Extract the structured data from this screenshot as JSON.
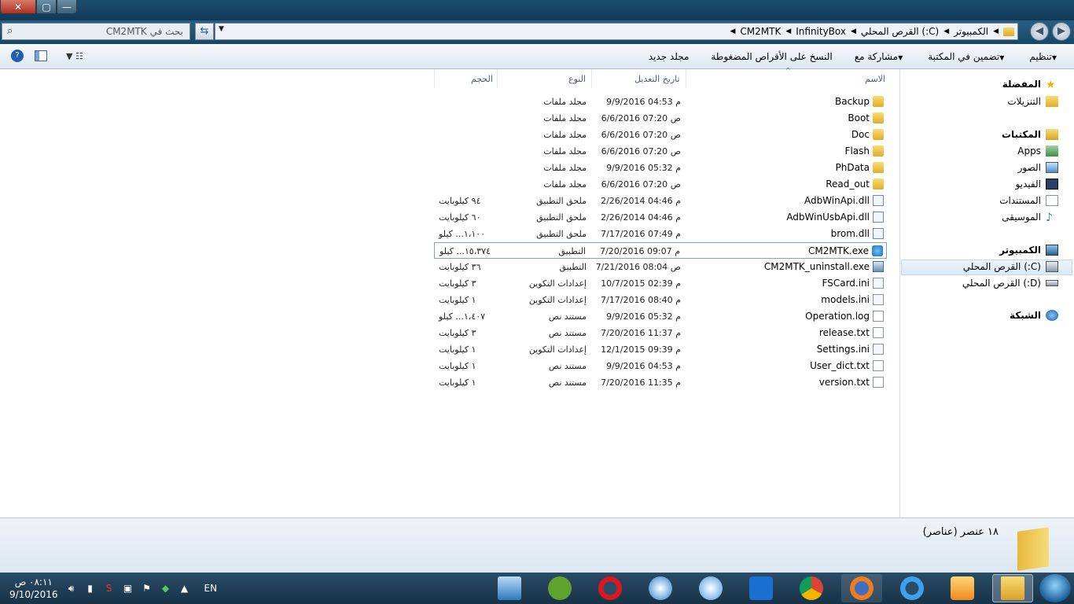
{
  "window": {
    "close_label": "✕",
    "max_label": "▢",
    "min_label": "—"
  },
  "address": {
    "search_placeholder": "بحث في CM2MTK",
    "crumbs": [
      "الكمبيوتر",
      "القرص المحلي (:C)",
      "InfinityBox",
      "CM2MTK"
    ]
  },
  "toolbar": {
    "organize": "تنظيم",
    "include_library": "تضمين في المكتبة",
    "share_with": "مشاركة مع",
    "burn": "النسخ على الأقراص المضغوطة",
    "new_folder": "مجلد جديد"
  },
  "columns": {
    "name": "الاسم",
    "date": "تاريخ التعديل",
    "type": "النوع",
    "size": "الحجم"
  },
  "files": [
    {
      "name": "Backup",
      "date": "9/9/2016 04:53 م",
      "type": "مجلد ملفات",
      "size": "",
      "icon": "folder-icon"
    },
    {
      "name": "Boot",
      "date": "6/6/2016 07:20 ص",
      "type": "مجلد ملفات",
      "size": "",
      "icon": "folder-icon"
    },
    {
      "name": "Doc",
      "date": "6/6/2016 07:20 ص",
      "type": "مجلد ملفات",
      "size": "",
      "icon": "folder-icon"
    },
    {
      "name": "Flash",
      "date": "6/6/2016 07:20 ص",
      "type": "مجلد ملفات",
      "size": "",
      "icon": "folder-icon"
    },
    {
      "name": "PhData",
      "date": "9/9/2016 05:32 م",
      "type": "مجلد ملفات",
      "size": "",
      "icon": "folder-icon"
    },
    {
      "name": "Read_out",
      "date": "6/6/2016 07:20 ص",
      "type": "مجلد ملفات",
      "size": "",
      "icon": "folder-icon"
    },
    {
      "name": "AdbWinApi.dll",
      "date": "2/26/2014 04:46 م",
      "type": "ملحق التطبيق",
      "size": "٩٤ كيلوبايت",
      "icon": "dll-icon"
    },
    {
      "name": "AdbWinUsbApi.dll",
      "date": "2/26/2014 04:46 م",
      "type": "ملحق التطبيق",
      "size": "٦٠ كيلوبايت",
      "icon": "dll-icon"
    },
    {
      "name": "brom.dll",
      "date": "7/17/2016 07:49 م",
      "type": "ملحق التطبيق",
      "size": "١،١٠٠... كيلو",
      "icon": "dll-icon"
    },
    {
      "name": "CM2MTK.exe",
      "date": "7/20/2016 09:07 م",
      "type": "التطبيق",
      "size": "١٥،٣٧٤... كيلو",
      "icon": "exe-icon"
    },
    {
      "name": "CM2MTK_uninstall.exe",
      "date": "7/21/2016 08:04 ص",
      "type": "التطبيق",
      "size": "٣٦ كيلوبايت",
      "icon": "uninstall-icon"
    },
    {
      "name": "FSCard.ini",
      "date": "10/7/2015 02:39 م",
      "type": "إعدادات التكوين",
      "size": "٣ كيلوبايت",
      "icon": "ini-icon"
    },
    {
      "name": "models.ini",
      "date": "7/17/2016 08:40 م",
      "type": "إعدادات التكوين",
      "size": "١ كيلوبايت",
      "icon": "ini-icon"
    },
    {
      "name": "Operation.log",
      "date": "9/9/2016 05:32 م",
      "type": "مستند نص",
      "size": "١،٤٠٧... كيلو",
      "icon": "text-file-icon"
    },
    {
      "name": "release.txt",
      "date": "7/20/2016 11:37 م",
      "type": "مستند نص",
      "size": "٣ كيلوبايت",
      "icon": "text-file-icon"
    },
    {
      "name": "Settings.ini",
      "date": "12/1/2015 09:39 م",
      "type": "إعدادات التكوين",
      "size": "١ كيلوبايت",
      "icon": "ini-icon"
    },
    {
      "name": "User_dict.txt",
      "date": "9/9/2016 04:53 م",
      "type": "مستند نص",
      "size": "١ كيلوبايت",
      "icon": "text-file-icon"
    },
    {
      "name": "version.txt",
      "date": "7/20/2016 11:35 م",
      "type": "مستند نص",
      "size": "١ كيلوبايت",
      "icon": "text-file-icon"
    }
  ],
  "nav": {
    "favorites": "المفضلة",
    "downloads": "التنزيلات",
    "libraries": "المكتبات",
    "apps": "Apps",
    "pictures": "الصور",
    "videos": "الفيديو",
    "documents": "المستندات",
    "music": "الموسيقى",
    "computer": "الكمبيوتر",
    "drive_c": "القرص المحلي (:C)",
    "drive_d": "القرص المحلي (:D)",
    "network": "الشبكة"
  },
  "status": {
    "count": "١٨ عنصر (عناصر)"
  },
  "taskbar": {
    "time": "٠٨:١١ ص",
    "date": "9/10/2016",
    "lang": "EN"
  }
}
